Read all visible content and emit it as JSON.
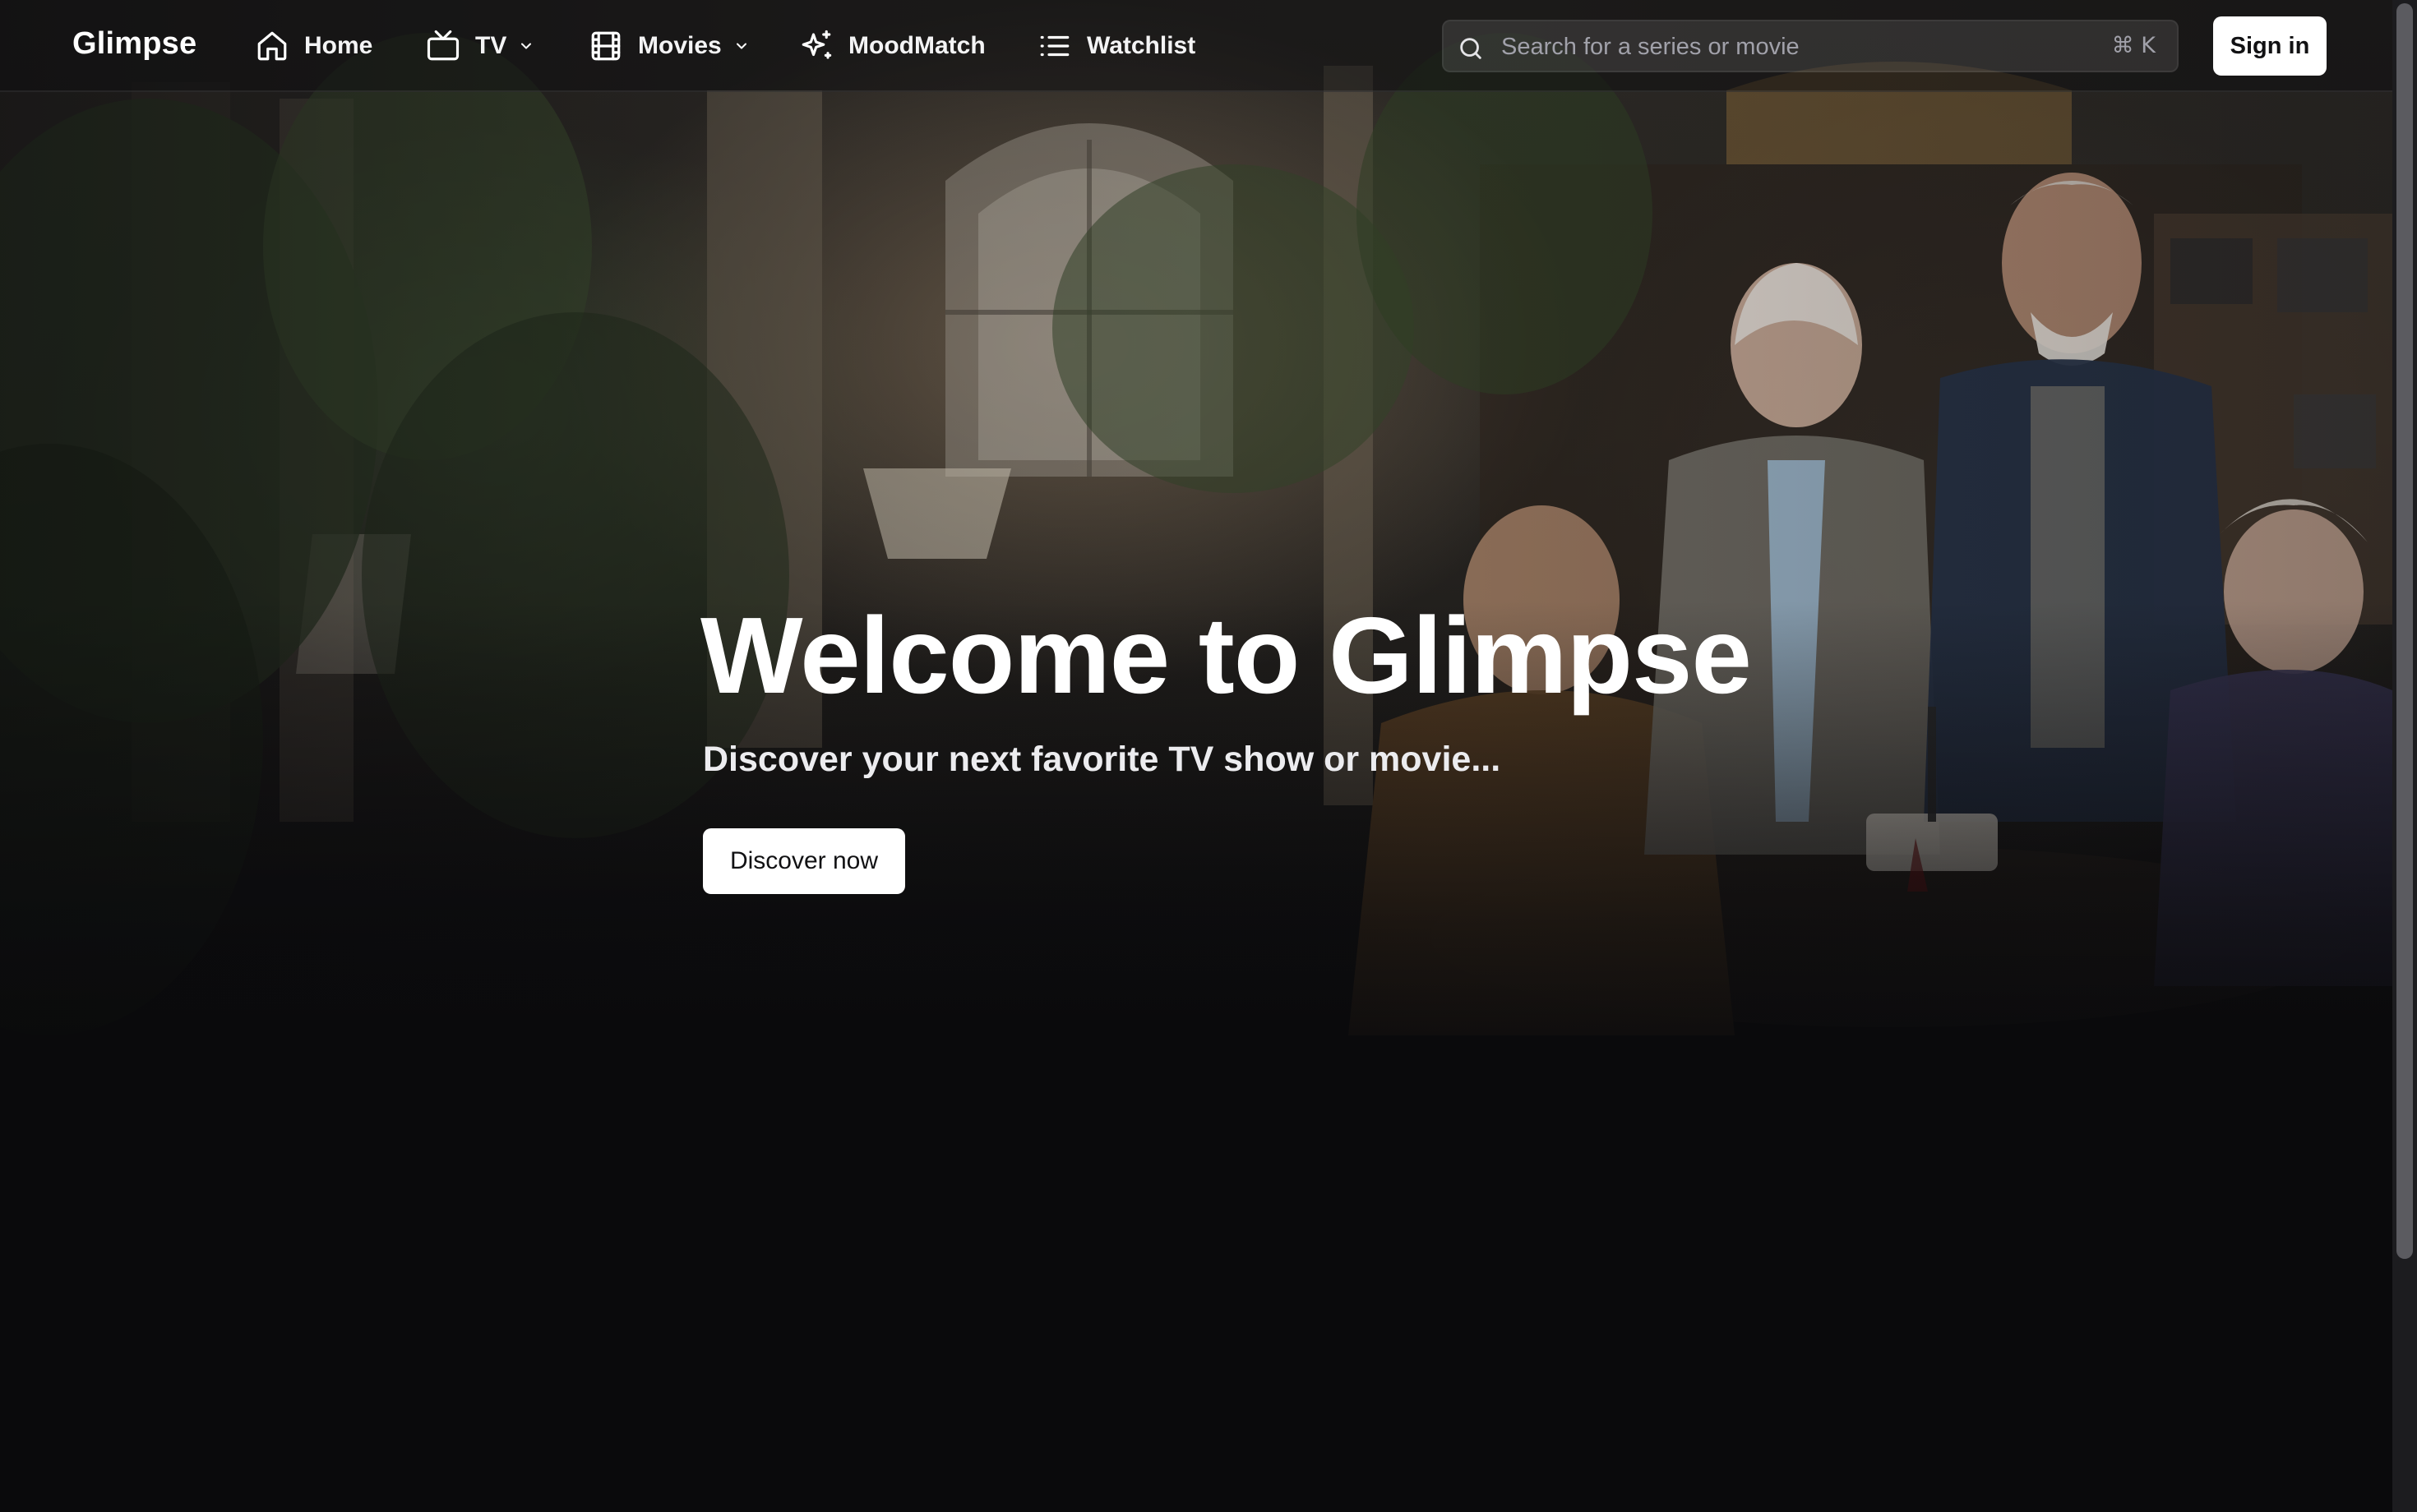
{
  "app": {
    "brand": "Glimpse"
  },
  "nav": {
    "items": [
      {
        "label": "Home",
        "icon": "home-icon"
      },
      {
        "label": "TV",
        "icon": "tv-icon",
        "dropdown": true
      },
      {
        "label": "Movies",
        "icon": "film-icon",
        "dropdown": true
      },
      {
        "label": "MoodMatch",
        "icon": "sparkles-icon"
      },
      {
        "label": "Watchlist",
        "icon": "list-icon"
      }
    ]
  },
  "search": {
    "placeholder": "Search for a series or movie",
    "value": "",
    "shortcut": "⌘ K",
    "icon": "search-icon"
  },
  "auth": {
    "signin_label": "Sign in"
  },
  "hero": {
    "title": "Welcome to Glimpse",
    "subtitle": "Discover your next favorite TV show or movie...",
    "cta_label": "Discover now"
  },
  "colors": {
    "background": "#0a0a0c",
    "button_bg": "#ffffff",
    "button_text": "#111113",
    "muted_text": "#a1a1aa"
  }
}
